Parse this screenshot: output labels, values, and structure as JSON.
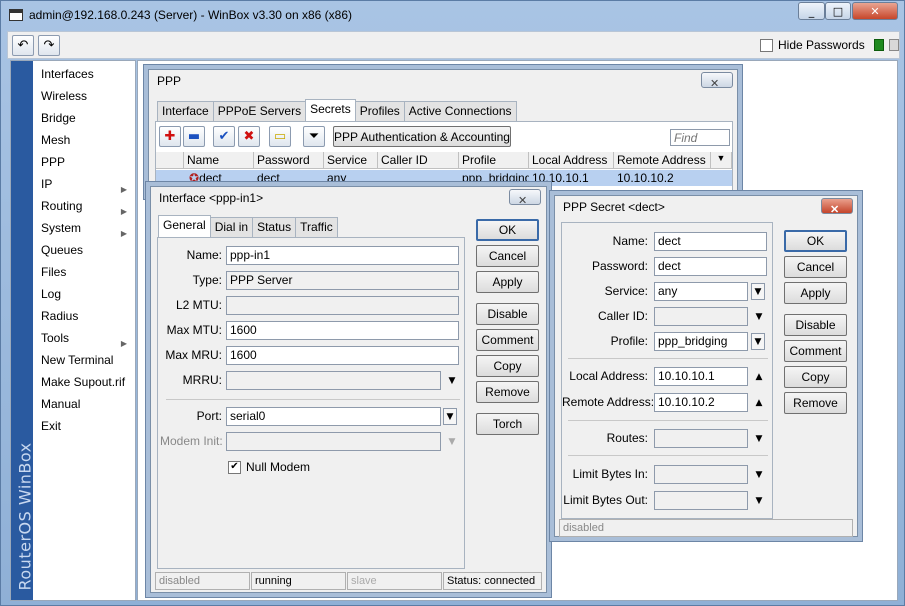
{
  "app": {
    "title": "admin@192.168.0.243 (Server) - WinBox v3.30 on x86 (x86)",
    "hide_passwords_label": "Hide Passwords",
    "brand_vertical": "RouterOS WinBox",
    "window_buttons": [
      "_",
      "□",
      "✕"
    ]
  },
  "sidebar": {
    "items": [
      {
        "label": "Interfaces",
        "arrow": false
      },
      {
        "label": "Wireless",
        "arrow": false
      },
      {
        "label": "Bridge",
        "arrow": false
      },
      {
        "label": "Mesh",
        "arrow": false
      },
      {
        "label": "PPP",
        "arrow": false
      },
      {
        "label": "IP",
        "arrow": true
      },
      {
        "label": "Routing",
        "arrow": true
      },
      {
        "label": "System",
        "arrow": true
      },
      {
        "label": "Queues",
        "arrow": false
      },
      {
        "label": "Files",
        "arrow": false
      },
      {
        "label": "Log",
        "arrow": false
      },
      {
        "label": "Radius",
        "arrow": false
      },
      {
        "label": "Tools",
        "arrow": true
      },
      {
        "label": "New Terminal",
        "arrow": false
      },
      {
        "label": "Make Supout.rif",
        "arrow": false
      },
      {
        "label": "Manual",
        "arrow": false
      },
      {
        "label": "Exit",
        "arrow": false
      }
    ]
  },
  "ppp_window": {
    "title": "PPP",
    "tabs": [
      "Interface",
      "PPPoE Servers",
      "Secrets",
      "Profiles",
      "Active Connections"
    ],
    "auth_button": "PPP Authentication & Accounting",
    "find_placeholder": "Find",
    "columns": [
      "Name",
      "Password",
      "Service",
      "Caller ID",
      "Profile",
      "Local Address",
      "Remote Address"
    ],
    "rows": [
      {
        "name": "dect",
        "password": "dect",
        "service": "any",
        "caller_id": "",
        "profile": "ppp_bridging",
        "local_address": "10.10.10.1",
        "remote_address": "10.10.10.2"
      }
    ]
  },
  "iface_window": {
    "title": "Interface <ppp-in1>",
    "tabs": [
      "General",
      "Dial in",
      "Status",
      "Traffic"
    ],
    "fields": {
      "name_label": "Name:",
      "name": "ppp-in1",
      "type_label": "Type:",
      "type": "PPP Server",
      "l2mtu_label": "L2 MTU:",
      "l2mtu": "",
      "maxmtu_label": "Max MTU:",
      "maxmtu": "1600",
      "maxmru_label": "Max MRU:",
      "maxmru": "1600",
      "mrru_label": "MRRU:",
      "mrru": "",
      "port_label": "Port:",
      "port": "serial0",
      "modeminit_label": "Modem Init:",
      "modeminit": "",
      "nullmodem_label": "Null Modem"
    },
    "buttons": [
      "OK",
      "Cancel",
      "Apply",
      "Disable",
      "Comment",
      "Copy",
      "Remove",
      "Torch"
    ],
    "status": [
      "disabled",
      "running",
      "slave",
      "Status: connected"
    ]
  },
  "secret_window": {
    "title": "PPP Secret <dect>",
    "fields": {
      "name_label": "Name:",
      "name": "dect",
      "password_label": "Password:",
      "password": "dect",
      "service_label": "Service:",
      "service": "any",
      "callerid_label": "Caller ID:",
      "callerid": "",
      "profile_label": "Profile:",
      "profile": "ppp_bridging",
      "local_label": "Local Address:",
      "local": "10.10.10.1",
      "remote_label": "Remote Address:",
      "remote": "10.10.10.2",
      "routes_label": "Routes:",
      "routes": "",
      "limitin_label": "Limit Bytes In:",
      "limitin": "",
      "limitout_label": "Limit Bytes Out:",
      "limitout": ""
    },
    "buttons": [
      "OK",
      "Cancel",
      "Apply",
      "Disable",
      "Comment",
      "Copy",
      "Remove"
    ],
    "status": "disabled"
  },
  "colors": {
    "accent": "#2a5aa0",
    "selected_row": "#b8d0f0",
    "add_icon": "#d01010",
    "check_icon": "#1a50c0"
  }
}
